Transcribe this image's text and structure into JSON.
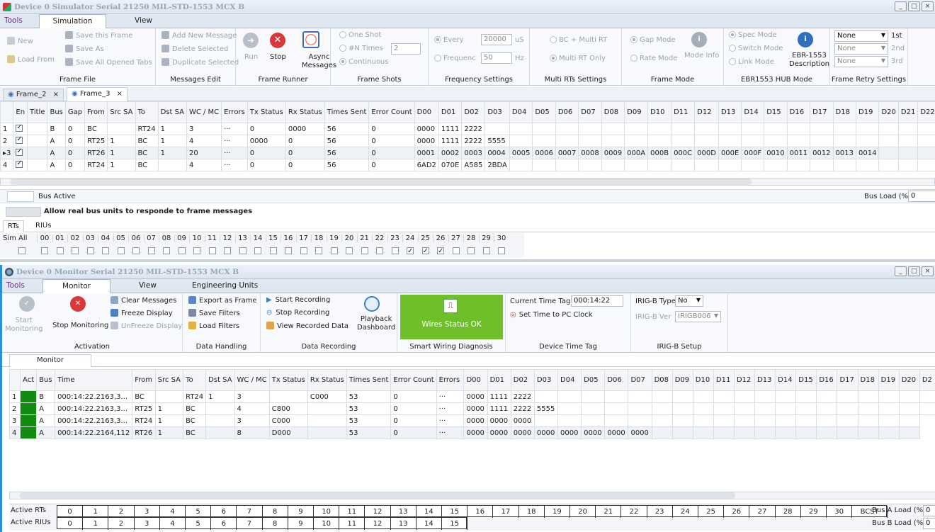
{
  "sim": {
    "title": "Device 0 Simulator Serial   21250     MIL-STD-1553   MCX B",
    "tabs": [
      "Tools",
      "Simulation",
      "View"
    ],
    "file": {
      "new": "New",
      "load": "Load From",
      "save": "Save this Frame",
      "saveas": "Save As",
      "saveall": "Save All Opened Tabs",
      "label": "Frame File"
    },
    "msg": {
      "add": "Add New Message",
      "del": "Delete Selected",
      "dup": "Duplicate Selected",
      "label": "Messages Edit"
    },
    "runner": {
      "run": "Run",
      "stop": "Stop",
      "async": "Async",
      "async2": "Messages",
      "label": "Frame Runner"
    },
    "shots": {
      "one": "One Shot",
      "n": "#N Times",
      "nval": "2",
      "cont": "Continuous",
      "label": "Frame Shots"
    },
    "freq": {
      "every": "Every",
      "everyval": "20000",
      "us": "uS",
      "frequenc": "Frequenc",
      "freqval": "50",
      "hz": "Hz",
      "label": "Frequency Settings"
    },
    "multi": {
      "a": "BC + Multi RT",
      "b": "Multi RT Only",
      "label": "Multi RTs Settings"
    },
    "mode": {
      "gap": "Gap Mode",
      "rate": "Rate Mode",
      "info": "Mode Info",
      "label": "Frame Mode"
    },
    "hub": {
      "spec": "Spec Mode",
      "switch": "Switch Mode",
      "link": "Link Mode",
      "desc1": "EBR-1553",
      "desc2": "Description",
      "label": "EBR1553 HUB Mode"
    },
    "retry": {
      "v1": "None",
      "l1": "1st",
      "v2": "None",
      "l2": "2nd",
      "v3": "None",
      "l3": "3rd",
      "label": "Frame Retry Settings"
    },
    "doctabs": [
      "Frame_2",
      "Frame_3"
    ],
    "cols": [
      "En",
      "Title",
      "Bus",
      "Gap",
      "From",
      "Src SA",
      "To",
      "Dst SA",
      "WC / MC",
      "Errors",
      "Tx Status",
      "Rx Status",
      "Times Sent",
      "Error Count",
      "D00",
      "D01",
      "D02",
      "D03",
      "D04",
      "D05",
      "D06",
      "D07",
      "D08",
      "D09",
      "D10",
      "D11",
      "D12",
      "D13",
      "D14",
      "D15",
      "D16",
      "D17",
      "D18",
      "D19",
      "D20",
      "D21",
      "D22"
    ],
    "rows": [
      {
        "idx": "1",
        "en": true,
        "cells": [
          "",
          "B",
          "0",
          "BC",
          "",
          "RT24",
          "1",
          "3",
          "···",
          "0",
          "0000",
          "56",
          "0",
          "0000",
          "1111",
          "2222",
          "",
          "",
          "",
          "",
          "",
          "",
          "",
          "",
          "",
          "",
          "",
          "",
          "",
          "",
          "",
          "",
          "",
          "",
          "",
          ""
        ]
      },
      {
        "idx": "2",
        "en": true,
        "cells": [
          "",
          "A",
          "0",
          "RT25",
          "1",
          "BC",
          "1",
          "4",
          "···",
          "0000",
          "0",
          "56",
          "0",
          "0000",
          "1111",
          "2222",
          "5555",
          "",
          "",
          "",
          "",
          "",
          "",
          "",
          "",
          "",
          "",
          "",
          "",
          "",
          "",
          "",
          "",
          "",
          "",
          ""
        ]
      },
      {
        "idx": "▸3",
        "en": true,
        "cells": [
          "",
          "A",
          "0",
          "RT26",
          "1",
          "BC",
          "1",
          "20",
          "···",
          "0",
          "0",
          "56",
          "0",
          "0001",
          "0002",
          "0003",
          "0004",
          "0005",
          "0006",
          "0007",
          "0008",
          "0009",
          "000A",
          "000B",
          "000C",
          "000D",
          "000E",
          "000F",
          "0010",
          "0011",
          "0012",
          "0013",
          "0014",
          "",
          "",
          ""
        ]
      },
      {
        "idx": "4",
        "en": true,
        "cells": [
          "",
          "A",
          "0",
          "RT24",
          "1",
          "BC",
          "",
          "4",
          "···",
          "0",
          "0",
          "56",
          "0",
          "6AD2",
          "070E",
          "A585",
          "2BDA",
          "",
          "",
          "",
          "",
          "",
          "",
          "",
          "",
          "",
          "",
          "",
          "",
          "",
          "",
          "",
          "",
          "",
          "",
          ""
        ]
      }
    ],
    "busactive": "Bus Active",
    "busload": "Bus Load (%)",
    "busloadval": "0",
    "allow": "Allow real bus units to responde to frame messages",
    "rttabs": [
      "RTs",
      "RIUs"
    ],
    "simall": "Sim All",
    "rtnums": [
      "00",
      "01",
      "02",
      "03",
      "04",
      "05",
      "06",
      "07",
      "08",
      "09",
      "10",
      "11",
      "12",
      "13",
      "14",
      "15",
      "16",
      "17",
      "18",
      "19",
      "20",
      "21",
      "22",
      "23",
      "24",
      "25",
      "26",
      "27",
      "28",
      "29",
      "30"
    ],
    "rtchecked": [
      24,
      25,
      26
    ]
  },
  "mon": {
    "title": "Device 0 Monitor Serial   21250     MIL-STD-1553   MCX B",
    "tabs": [
      "Tools",
      "Monitor",
      "View",
      "Engineering Units"
    ],
    "act": {
      "start": "Start",
      "start2": "Monitoring",
      "stop": "Stop Monitoring",
      "clear": "Clear Messages",
      "freeze": "Freeze Display",
      "unfreeze": "UnFreeze Display",
      "label": "Activation"
    },
    "dh": {
      "export": "Export as Frame",
      "save": "Save Filters",
      "load": "Load Filters",
      "label": "Data Handling"
    },
    "rec": {
      "start": "Start Recording",
      "stop": "Stop Recording",
      "view": "View Recorded Data",
      "pb1": "Playback",
      "pb2": "Dashboard",
      "label": "Data Recording"
    },
    "wire": {
      "status": "Wires Status OK",
      "label": "Smart Wiring Diagnosis"
    },
    "time": {
      "cur": "Current Time Tag",
      "val": "000:14:22",
      "set": "Set Time to PC Clock",
      "label": "Device Time Tag"
    },
    "irig": {
      "type": "IRIG-B Type",
      "typeval": "No",
      "ver": "IRIG-B Ver",
      "verval": "IRIGB006",
      "label": "IRIG-B Setup"
    },
    "doctab": "Monitor",
    "cols": [
      "Act",
      "Bus",
      "Time",
      "From",
      "Src SA",
      "To",
      "Dst SA",
      "WC / MC",
      "Tx Status",
      "Rx Status",
      "Times Sent",
      "Error Count",
      "Errors",
      "D00",
      "D01",
      "D02",
      "D03",
      "D04",
      "D05",
      "D06",
      "D07",
      "D08",
      "D09",
      "D10",
      "D11",
      "D12",
      "D13",
      "D14",
      "D15",
      "D16",
      "D17",
      "D18",
      "D19",
      "D20",
      "D2"
    ],
    "rows": [
      {
        "idx": "1",
        "cells": [
          "B",
          "000:14:22.2163,3...",
          "BC",
          "",
          "RT24",
          "1",
          "3",
          "",
          "C000",
          "53",
          "0",
          "···",
          "0000",
          "1111",
          "2222",
          "",
          "",
          "",
          "",
          "",
          "",
          "",
          "",
          "",
          "",
          "",
          "",
          "",
          "",
          "",
          "",
          "",
          "",
          ""
        ]
      },
      {
        "idx": "2",
        "cells": [
          "A",
          "000:14:22.2163,3...",
          "RT25",
          "1",
          "BC",
          "",
          "4",
          "C800",
          "",
          "53",
          "0",
          "···",
          "0000",
          "1111",
          "2222",
          "5555",
          "",
          "",
          "",
          "",
          "",
          "",
          "",
          "",
          "",
          "",
          "",
          "",
          "",
          "",
          "",
          "",
          "",
          ""
        ]
      },
      {
        "idx": "3",
        "cells": [
          "A",
          "000:14:22.2163,3...",
          "RT24",
          "1",
          "BC",
          "",
          "3",
          "C000",
          "",
          "53",
          "0",
          "···",
          "0000",
          "0000",
          "0000",
          "",
          "",
          "",
          "",
          "",
          "",
          "",
          "",
          "",
          "",
          "",
          "",
          "",
          "",
          "",
          "",
          "",
          ""
        ]
      },
      {
        "idx": "4",
        "cells": [
          "A",
          "000:14:22.2164,112",
          "RT26",
          "1",
          "BC",
          "",
          "8",
          "D000",
          "",
          "53",
          "0",
          "···",
          "0000",
          "0000",
          "0000",
          "0000",
          "0000",
          "0000",
          "0000",
          "0000",
          "",
          "",
          "",
          "",
          "",
          "",
          "",
          "",
          "",
          "",
          "",
          "",
          ""
        ]
      }
    ],
    "activerts": "Active RTs",
    "activerius": "Active RIUs",
    "rtnums": [
      "0",
      "1",
      "2",
      "3",
      "4",
      "5",
      "6",
      "7",
      "8",
      "9",
      "10",
      "11",
      "12",
      "13",
      "14",
      "15",
      "16",
      "17",
      "18",
      "19",
      "20",
      "21",
      "22",
      "23",
      "24",
      "25",
      "26",
      "27",
      "28",
      "29",
      "30",
      "BCST"
    ],
    "riunums": [
      "0",
      "1",
      "2",
      "3",
      "4",
      "5",
      "6",
      "7",
      "8",
      "9",
      "10",
      "11",
      "12",
      "13",
      "14",
      "15"
    ],
    "busa": "Bus A Load (%)",
    "busaval": "0",
    "busb": "Bus B Load (%)",
    "busbval": "0"
  },
  "colors": {
    "accent": "#6fbf2a",
    "act": "#118c11",
    "stopred": "#d9383a"
  }
}
